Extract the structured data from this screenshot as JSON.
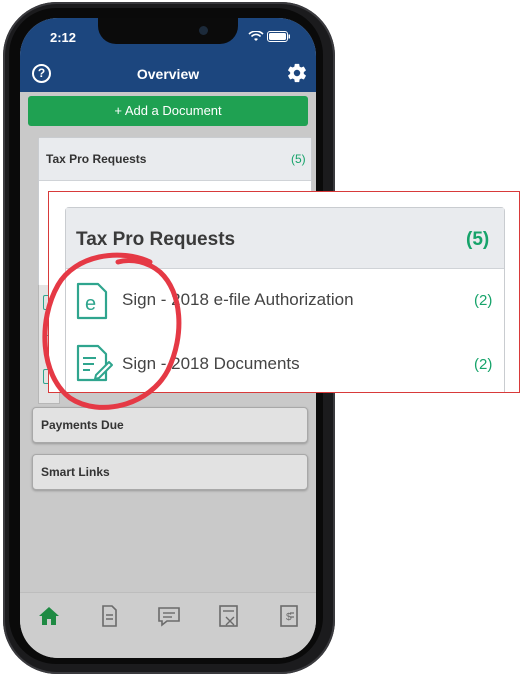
{
  "status": {
    "time": "2:12",
    "icons": "wifi battery"
  },
  "nav": {
    "title": "Overview",
    "help_icon": "help-circle-icon",
    "settings_icon": "gear-icon"
  },
  "add_document_label": "+ Add a Document",
  "tax_pro_card": {
    "title": "Tax Pro Requests",
    "count": "(5)"
  },
  "sections": [
    {
      "label": "Payments Due"
    },
    {
      "label": "Smart Links"
    }
  ],
  "zoom_card": {
    "title": "Tax Pro Requests",
    "count": "(5)",
    "items": [
      {
        "label": "Sign - 2018 e-file Authorization",
        "count": "(2)",
        "icon": "e-file-document-icon"
      },
      {
        "label": "Sign - 2018 Documents",
        "count": "(2)",
        "icon": "sign-document-icon"
      }
    ]
  },
  "tabbar": [
    "home-icon",
    "documents-icon",
    "messages-icon",
    "tax-return-icon",
    "invoice-icon"
  ],
  "colors": {
    "header": "#1c467e",
    "accent_green": "#1fa152",
    "count_green": "#16a36a",
    "annotation_red": "#e53945",
    "callout_border": "#d83a3a"
  }
}
